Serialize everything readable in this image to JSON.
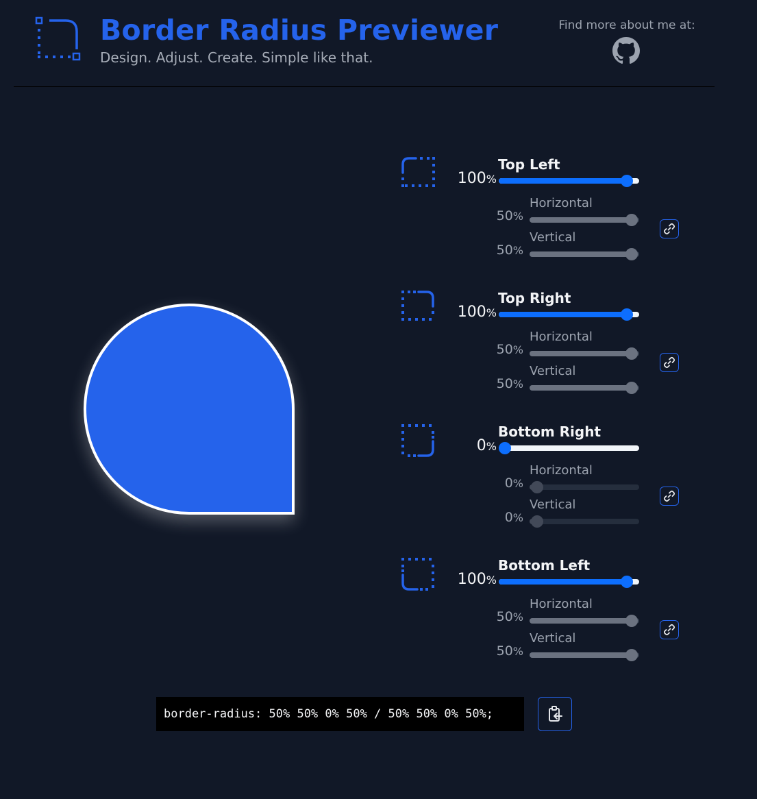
{
  "header": {
    "title": "Border Radius Previewer",
    "subtitle": "Design. Adjust. Create. Simple like that.",
    "find_more": "Find more about me at:",
    "github_icon": "github-icon",
    "logo_icon": "border-radius-logo-icon"
  },
  "colors": {
    "accent": "#2563eb",
    "slider_active": "#0d6efd",
    "background": "#111827",
    "shape_fill": "#2563eb",
    "shape_border": "#ffffff"
  },
  "corners": [
    {
      "id": "top-left",
      "label": "Top Left",
      "value": "100",
      "unit": "%",
      "level": 100,
      "horizontal_label": "Horizontal",
      "horizontal_value": "50",
      "horizontal_level": 100,
      "vertical_label": "Vertical",
      "vertical_value": "50",
      "vertical_level": 100
    },
    {
      "id": "top-right",
      "label": "Top Right",
      "value": "100",
      "unit": "%",
      "level": 100,
      "horizontal_label": "Horizontal",
      "horizontal_value": "50",
      "horizontal_level": 100,
      "vertical_label": "Vertical",
      "vertical_value": "50",
      "vertical_level": 100
    },
    {
      "id": "bottom-right",
      "label": "Bottom Right",
      "value": "0",
      "unit": "%",
      "level": 0,
      "horizontal_label": "Horizontal",
      "horizontal_value": "0",
      "horizontal_level": 0,
      "vertical_label": "Vertical",
      "vertical_value": "0",
      "vertical_level": 0
    },
    {
      "id": "bottom-left",
      "label": "Bottom Left",
      "value": "100",
      "unit": "%",
      "level": 100,
      "horizontal_label": "Horizontal",
      "horizontal_value": "50",
      "horizontal_level": 100,
      "vertical_label": "Vertical",
      "vertical_value": "50",
      "vertical_level": 100
    }
  ],
  "link_icon": "link-icon",
  "css_output": "border-radius: 50% 50% 0% 50% / 50% 50% 0% 50%;",
  "copy_icon": "clipboard-copy-icon"
}
